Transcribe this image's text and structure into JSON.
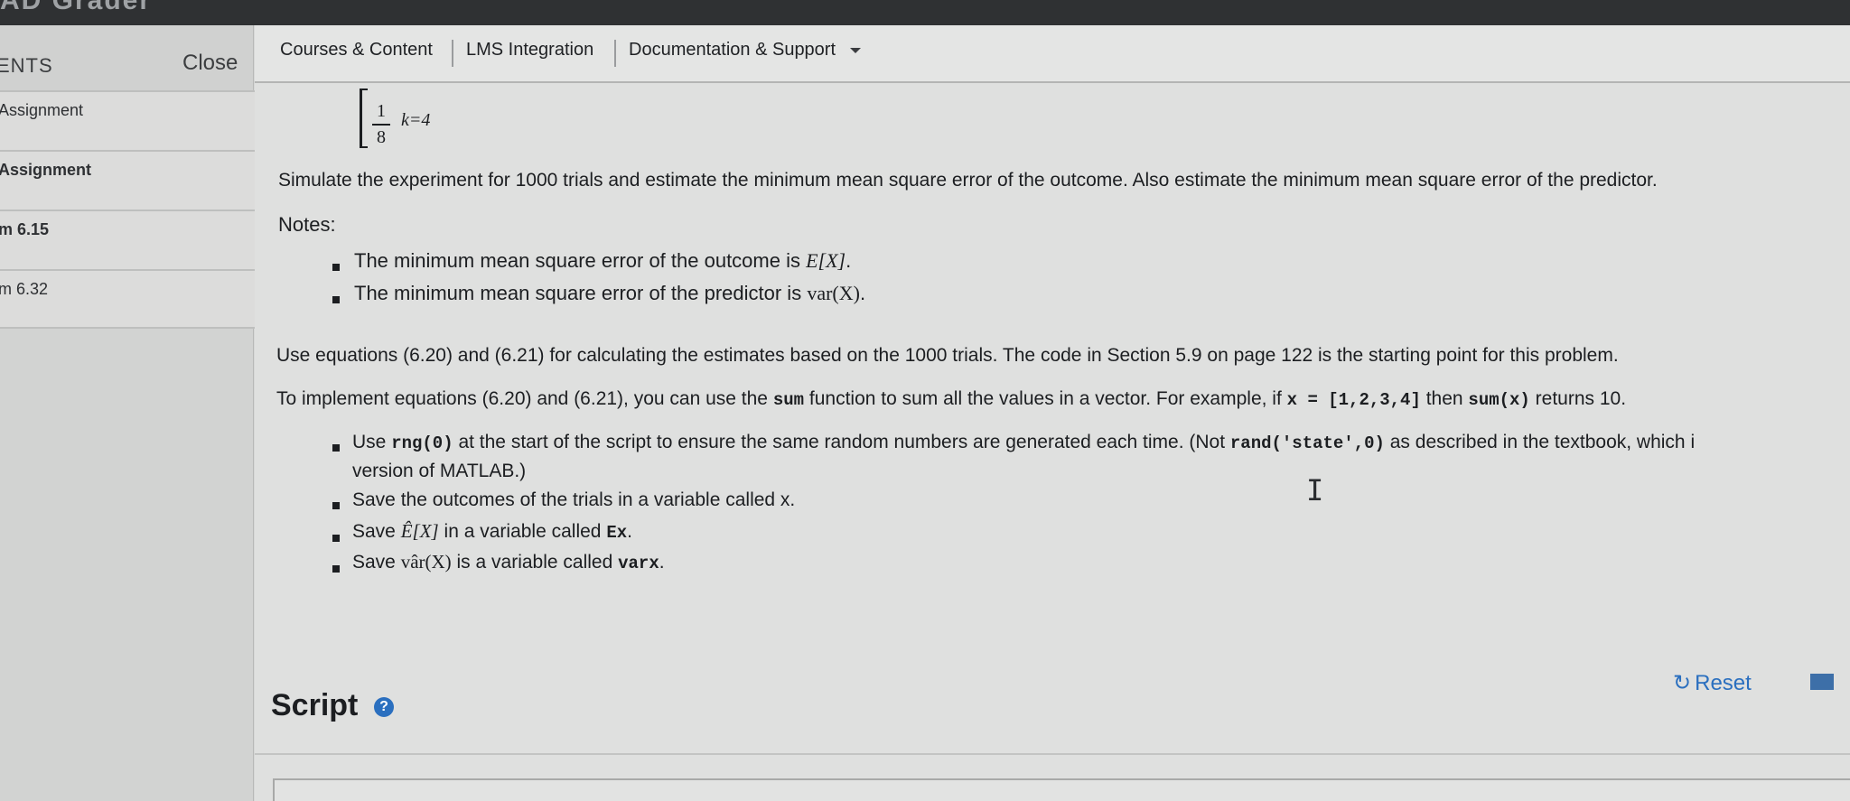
{
  "brand": "AD Grader",
  "sidebar": {
    "title": "ENTS",
    "close_label": "Close",
    "items": [
      {
        "label": "Assignment"
      },
      {
        "label": "Assignment"
      },
      {
        "label": "m 6.15"
      },
      {
        "label": "m 6.32"
      }
    ]
  },
  "nav": {
    "items": [
      {
        "label": "Courses & Content"
      },
      {
        "label": "LMS Integration"
      },
      {
        "label": "Documentation & Support"
      }
    ]
  },
  "problem": {
    "frac_num": "1",
    "frac_den": "8",
    "case": "k=4",
    "intro": "Simulate the experiment for 1000 trials and estimate the minimum mean square error of the outcome.  Also estimate the minimum mean square error of the predictor.",
    "notes_label": "Notes:",
    "note1_text": "The minimum mean square error of the outcome is ",
    "note1_math": "E[X]",
    "note1_end": ".",
    "note2_text": "The minimum mean square error of the predictor is ",
    "note2_math": "var(X)",
    "note2_end": ".",
    "para1": "Use equations (6.20) and (6.21) for calculating the estimates based on the 1000 trials.  The code in Section 5.9 on page 122 is the starting point for this problem.",
    "para2_a": "To implement equations (6.20) and (6.21), you can use the ",
    "para2_code1": "sum",
    "para2_b": " function to sum all the values in a vector.  For example, if ",
    "para2_code2": "x = [1,2,3,4]",
    "para2_c": " then ",
    "para2_code3": "sum(x)",
    "para2_d": " returns 10.",
    "b1_a": "Use ",
    "b1_code1": "rng(0)",
    "b1_b": " at the start of the script to ensure the same random numbers are generated each time.  (Not ",
    "b1_code2": "rand('state',0)",
    "b1_c": " as described in the textbook, which i",
    "b1_line2": "version of MATLAB.)",
    "b2": "Save the outcomes of the trials in a variable called x.",
    "b3_a": "Save ",
    "b3_math": "Ê[X]",
    "b3_b": " in a variable called ",
    "b3_code": "Ex",
    "b3_c": ".",
    "b4_a": "Save ",
    "b4_math": "vâr(X)",
    "b4_b": " is a variable called ",
    "b4_code": "varx",
    "b4_c": "."
  },
  "script": {
    "title": "Script",
    "help_glyph": "?",
    "reset_label": "Reset",
    "reset_icon": "reset-icon"
  }
}
